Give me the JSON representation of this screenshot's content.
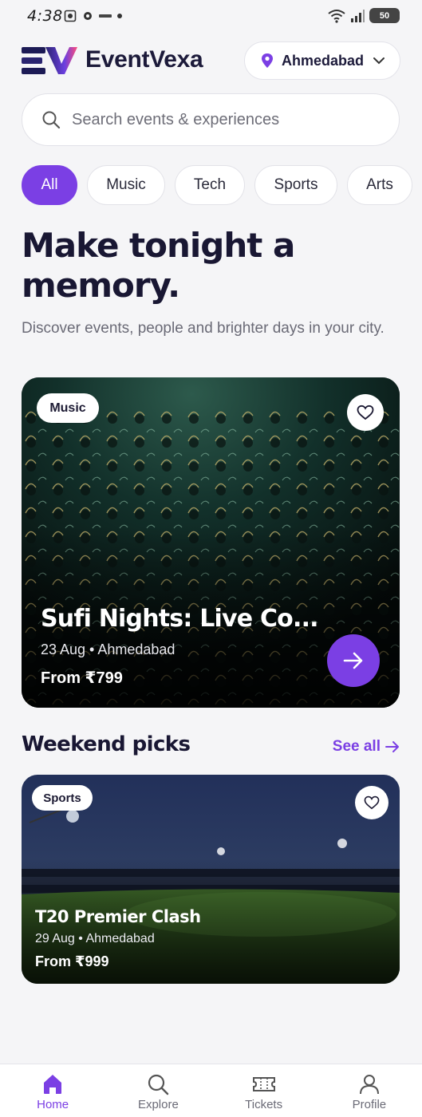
{
  "status_bar": {
    "time": "4:38",
    "battery": "50"
  },
  "header": {
    "brand": "EventVexa",
    "location": "Ahmedabad"
  },
  "search": {
    "placeholder": "Search events & experiences"
  },
  "categories": [
    "All",
    "Music",
    "Tech",
    "Sports",
    "Arts"
  ],
  "hero": {
    "headline_line1": "Make tonight a",
    "headline_line2": "memory.",
    "subhead": "Discover events, people and brighter days in your city."
  },
  "featured": {
    "tag": "Music",
    "title": "Sufi Nights: Live Co...",
    "meta": "23 Aug • Ahmedabad",
    "price": "From ₹799"
  },
  "weekend": {
    "title": "Weekend picks",
    "see_all": "See all",
    "card": {
      "tag": "Sports",
      "title": "T20 Premier Clash",
      "meta": "29 Aug • Ahmedabad",
      "price": "From ₹999"
    }
  },
  "nav": {
    "items": [
      {
        "label": "Home",
        "icon": "home-icon"
      },
      {
        "label": "Explore",
        "icon": "search-icon"
      },
      {
        "label": "Tickets",
        "icon": "ticket-icon"
      },
      {
        "label": "Profile",
        "icon": "profile-icon"
      }
    ]
  },
  "colors": {
    "accent": "#7b3fe4",
    "ink": "#191733",
    "background": "#f5f5f7"
  }
}
